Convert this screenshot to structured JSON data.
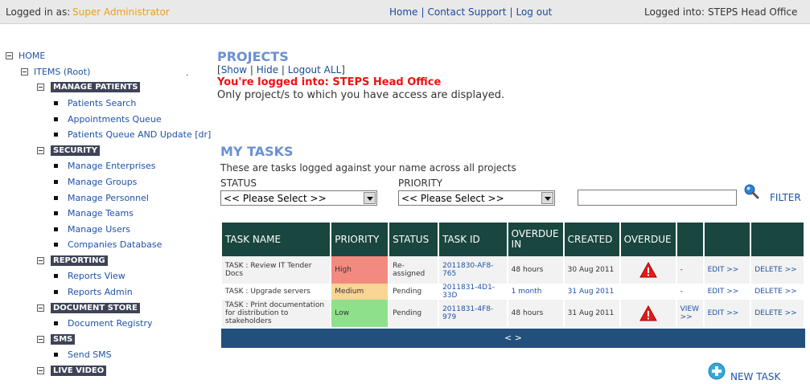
{
  "topbar": {
    "logged_in_label": "Logged in as:",
    "logged_in_user": "Super Administrator",
    "links": [
      "Home",
      "Contact Support",
      "Log out"
    ],
    "logged_into_label": "Logged into:",
    "logged_into_office": "STEPS Head Office"
  },
  "sidebar": {
    "home": "HOME",
    "items_root": "ITEMS (Root)",
    "dot": ".",
    "groups": [
      {
        "label": "MANAGE PATIENTS",
        "items": [
          "Patients Search",
          "Appointments Queue",
          "Patients Queue AND Update [dr]"
        ]
      },
      {
        "label": "SECURITY",
        "items": [
          "Manage Enterprises",
          "Manage Groups",
          "Manage Personnel",
          "Manage Teams",
          "Manage Users",
          "Companies Database"
        ]
      },
      {
        "label": "REPORTING",
        "items": [
          "Reports View",
          "Reports Admin"
        ]
      },
      {
        "label": "DOCUMENT STORE",
        "items": [
          "Document Registry"
        ]
      },
      {
        "label": "SMS",
        "items": [
          "Send SMS"
        ]
      },
      {
        "label": "LIVE VIDEO",
        "items": []
      }
    ]
  },
  "projects": {
    "title": "PROJECTS",
    "show": "Show",
    "hide": "Hide",
    "logout_all": "Logout ALL",
    "logged_msg": "You're logged into: STEPS Head Office",
    "access_msg": "Only project/s to which you have access are displayed."
  },
  "tasks": {
    "title": "MY TASKS",
    "description": "These are tasks logged against your name across all projects",
    "status_label": "STATUS",
    "priority_label": "PRIORITY",
    "status_value": "<< Please Select >>",
    "priority_value": "<< Please Select >>",
    "search_value": "",
    "filter_label": "FILTER",
    "columns": [
      "TASK NAME",
      "PRIORITY",
      "STATUS",
      "TASK ID",
      "OVERDUE IN",
      "CREATED",
      "OVERDUE",
      "",
      "",
      ""
    ],
    "rows": [
      {
        "name": "TASK : Review IT Tender Docs",
        "priority": "High",
        "priority_class": "high",
        "status": "Re-assigned",
        "task_id": "2011830-AF8-765",
        "overdue_in": "48 hours",
        "created": "30 Aug 2011",
        "overdue": true,
        "view": "-",
        "edit": "EDIT >>",
        "delete": "DELETE >>"
      },
      {
        "name": "TASK : Upgrade servers",
        "priority": "Medium",
        "priority_class": "medium",
        "status": "Pending",
        "task_id": "2011831-4D1-33D",
        "overdue_in": "1 month",
        "created": "31 Aug 2011",
        "overdue": false,
        "view": "-",
        "edit": "EDIT >>",
        "delete": "DELETE >>"
      },
      {
        "name": "TASK : Print documentation for distribution to stakeholders",
        "priority": "Low",
        "priority_class": "low",
        "status": "Pending",
        "task_id": "2011831-4F8-979",
        "overdue_in": "48 hours",
        "created": "31 Aug 2011",
        "overdue": true,
        "view": "VIEW >>",
        "edit": "EDIT >>",
        "delete": "DELETE >>"
      }
    ],
    "pager": "< >",
    "new_task": "NEW TASK"
  }
}
